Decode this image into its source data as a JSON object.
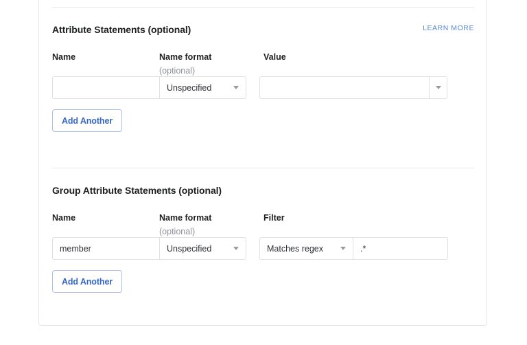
{
  "card": {
    "sections": [
      {
        "id": "attribute-statements",
        "title": "Attribute Statements (optional)",
        "learn_more_label": "LEARN MORE",
        "columns": [
          {
            "label": "Name",
            "sub": ""
          },
          {
            "label": "Name format",
            "sub": "(optional)"
          },
          {
            "label": "Value",
            "sub": ""
          }
        ],
        "row": {
          "name_value": "",
          "name_placeholder": "",
          "name_format_value": "Unspecified",
          "value_value": "",
          "value_placeholder": ""
        },
        "add_button_label": "Add Another"
      },
      {
        "id": "group-attribute-statements",
        "title": "Group Attribute Statements (optional)",
        "learn_more_label": "",
        "columns": [
          {
            "label": "Name",
            "sub": ""
          },
          {
            "label": "Name format",
            "sub": "(optional)"
          },
          {
            "label": "Filter",
            "sub": ""
          }
        ],
        "row": {
          "name_value": "member",
          "name_placeholder": "",
          "name_format_value": "Unspecified",
          "filter_type_value": "Matches regex",
          "filter_value": ".*",
          "filter_placeholder": ""
        },
        "add_button_label": "Add Another"
      }
    ]
  },
  "colors": {
    "link_blue": "#5a87d8",
    "button_blue": "#3667c4",
    "button_border_blue": "#a8c1ea",
    "text_dark": "#1d1f21",
    "text_muted": "#8e9199",
    "field_border": "#dfe0e1",
    "divider": "#e8e9eb",
    "card_border": "#e3e4e7"
  }
}
